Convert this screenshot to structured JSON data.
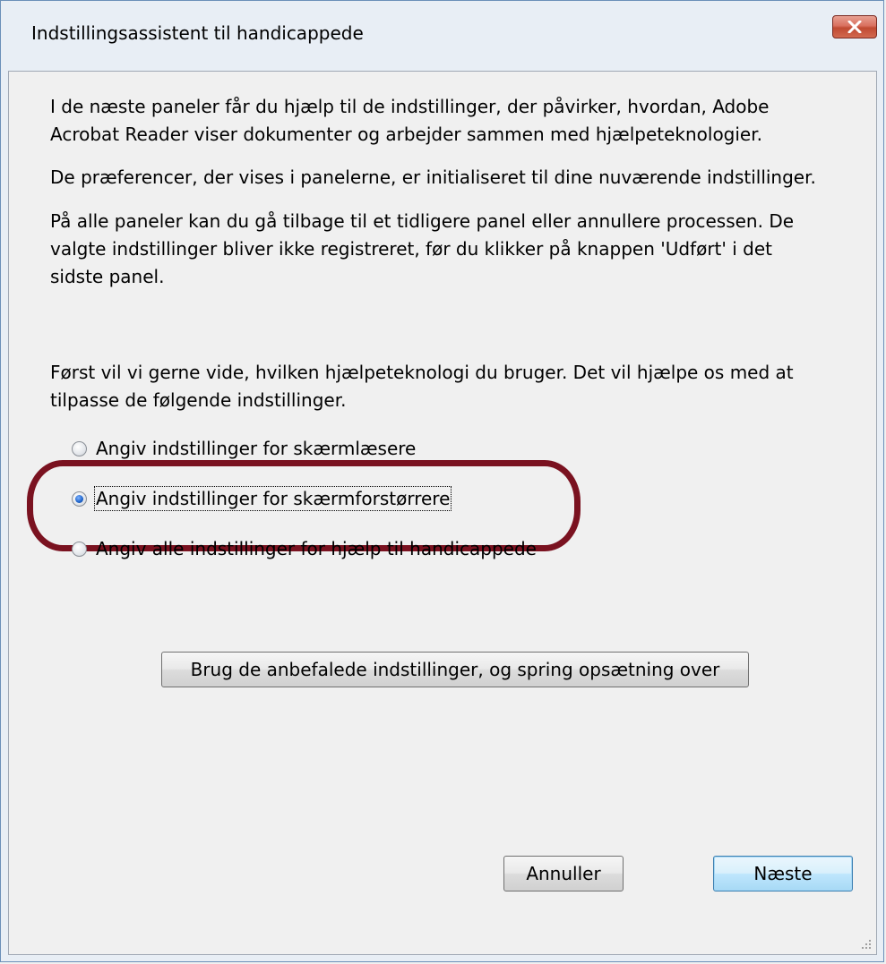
{
  "window": {
    "title": "Indstillingsassistent til handicappede"
  },
  "intro": {
    "para1_line1": "I de næste paneler får du hjælp til de indstillinger, der påvirker, hvordan, Adobe",
    "para1_line2": "Acrobat Reader viser dokumenter og arbejder sammen med hjælpeteknologier.",
    "para2": "De præferencer, der vises i panelerne, er initialiseret til dine nuværende indstillinger.",
    "para3_line1": "På alle paneler kan du gå tilbage til et tidligere panel eller annullere processen. De",
    "para3_line2": "valgte indstillinger bliver ikke registreret, før du klikker på knappen 'Udført' i det",
    "para3_line3": "sidste panel.",
    "question_line1": "Først vil vi gerne vide, hvilken hjælpeteknologi du bruger. Det vil hjælpe os med at",
    "question_line2": "tilpasse de følgende indstillinger."
  },
  "options": [
    {
      "label": "Angiv indstillinger for skærmlæsere",
      "checked": false
    },
    {
      "label": "Angiv indstillinger for skærmforstørrere",
      "checked": true
    },
    {
      "label": "Angiv alle indstillinger for hjælp til handicappede",
      "checked": false
    }
  ],
  "buttons": {
    "recommended": "Brug de anbefalede indstillinger, og spring opsætning over",
    "cancel": "Annuller",
    "next": "Næste"
  },
  "colors": {
    "highlight": "#7a1220",
    "radio_selected": "#1d63c9"
  }
}
